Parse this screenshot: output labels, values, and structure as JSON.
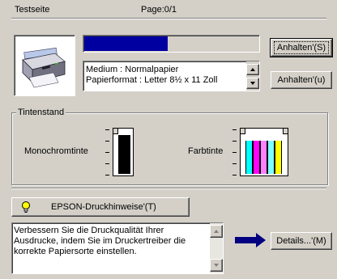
{
  "header": {
    "doc_name": "Testseite",
    "page_label": "Page:0/1"
  },
  "progress": {
    "fraction": 0.48
  },
  "printer_image": {
    "icon": "printer-icon"
  },
  "media_info": {
    "line1": "Medium : Normalpapier",
    "line2": "Papierformat : Letter 8½ x 11 Zoll"
  },
  "buttons": {
    "pause_s": "Anhalten'(S)",
    "pause_u": "Anhalten'(u)",
    "tips": "EPSON-Druckhinweise'(T)",
    "details": "Details...'(M)"
  },
  "ink": {
    "group_label": "Tintenstand",
    "mono_label": "Monochromtinte",
    "color_label": "Farbtinte",
    "mono_level": 1.0,
    "colors": [
      {
        "name": "cyan",
        "color": "#00ffff",
        "level": 0.85
      },
      {
        "name": "magenta",
        "color": "#ff00ff",
        "level": 0.85
      },
      {
        "name": "light-magenta",
        "color": "#ff80ff",
        "level": 0.85
      },
      {
        "name": "light-cyan",
        "color": "#80ffff",
        "level": 0.85
      },
      {
        "name": "yellow",
        "color": "#ffff00",
        "level": 0.85
      }
    ]
  },
  "tips_text": "Verbessern Sie die Druckqualität Ihrer Ausdrucke, indem Sie im Druckertreiber die korrekte Papiersorte einstellen.",
  "colors": {
    "progress_fill": "#0000a0",
    "arrow": "#000080",
    "bulb": "#ffff00"
  }
}
